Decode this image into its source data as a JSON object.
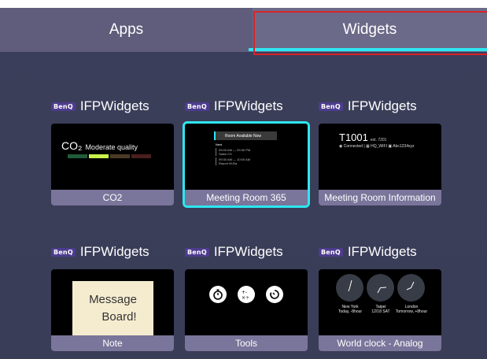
{
  "tabs": {
    "apps": "Apps",
    "widgets": "Widgets",
    "selected": "Widgets"
  },
  "colors": {
    "accent": "#2ee6f0",
    "highlight_box": "#d8232a",
    "tabbar": "#5f5d7b",
    "background": "#3b3e5a",
    "label_bg": "#7a759a"
  },
  "widgets": [
    {
      "brand": "BenQ",
      "provider": "IFPWidgets",
      "name": "CO2",
      "preview": {
        "co2_label": "CO₂",
        "quality": "Moderate quality",
        "bar_colors": [
          "#1f5c3a",
          "#c8f24a",
          "#4a3a25",
          "#4a1f1f"
        ]
      }
    },
    {
      "brand": "BenQ",
      "provider": "IFPWidgets",
      "name": "Meeting Room 365",
      "selected": true,
      "preview": {
        "status": "Room Available Now",
        "next": "Next",
        "events": [
          {
            "time": "09:00 AM — 09:30 PM",
            "title": "Sales CS"
          },
          {
            "time": "09:30 AM — 10:00 AM",
            "title": "Report W-Ba"
          }
        ]
      }
    },
    {
      "brand": "BenQ",
      "provider": "IFPWidgets",
      "name": "Meeting Room Information",
      "preview": {
        "room": "T1001",
        "ext": "ext. 7201",
        "status": "Connected",
        "wifi": "HQ_WIFI",
        "password": "Abc1234xyz"
      }
    },
    {
      "brand": "BenQ",
      "provider": "IFPWidgets",
      "name": "Note",
      "preview": {
        "line1": "Message",
        "line2": "Board!"
      }
    },
    {
      "brand": "BenQ",
      "provider": "IFPWidgets",
      "name": "Tools",
      "preview": {
        "icons": [
          "stopwatch-icon",
          "calculator-icon",
          "timer-icon"
        ]
      }
    },
    {
      "brand": "BenQ",
      "provider": "IFPWidgets",
      "name": "World clock - Analog",
      "preview": {
        "cities": [
          {
            "name": "New York",
            "sub": "Today, -8hour"
          },
          {
            "name": "Taipei",
            "sub": "12/18 SAT"
          },
          {
            "name": "London",
            "sub": "Tomorrow, +8hour"
          }
        ]
      }
    }
  ]
}
